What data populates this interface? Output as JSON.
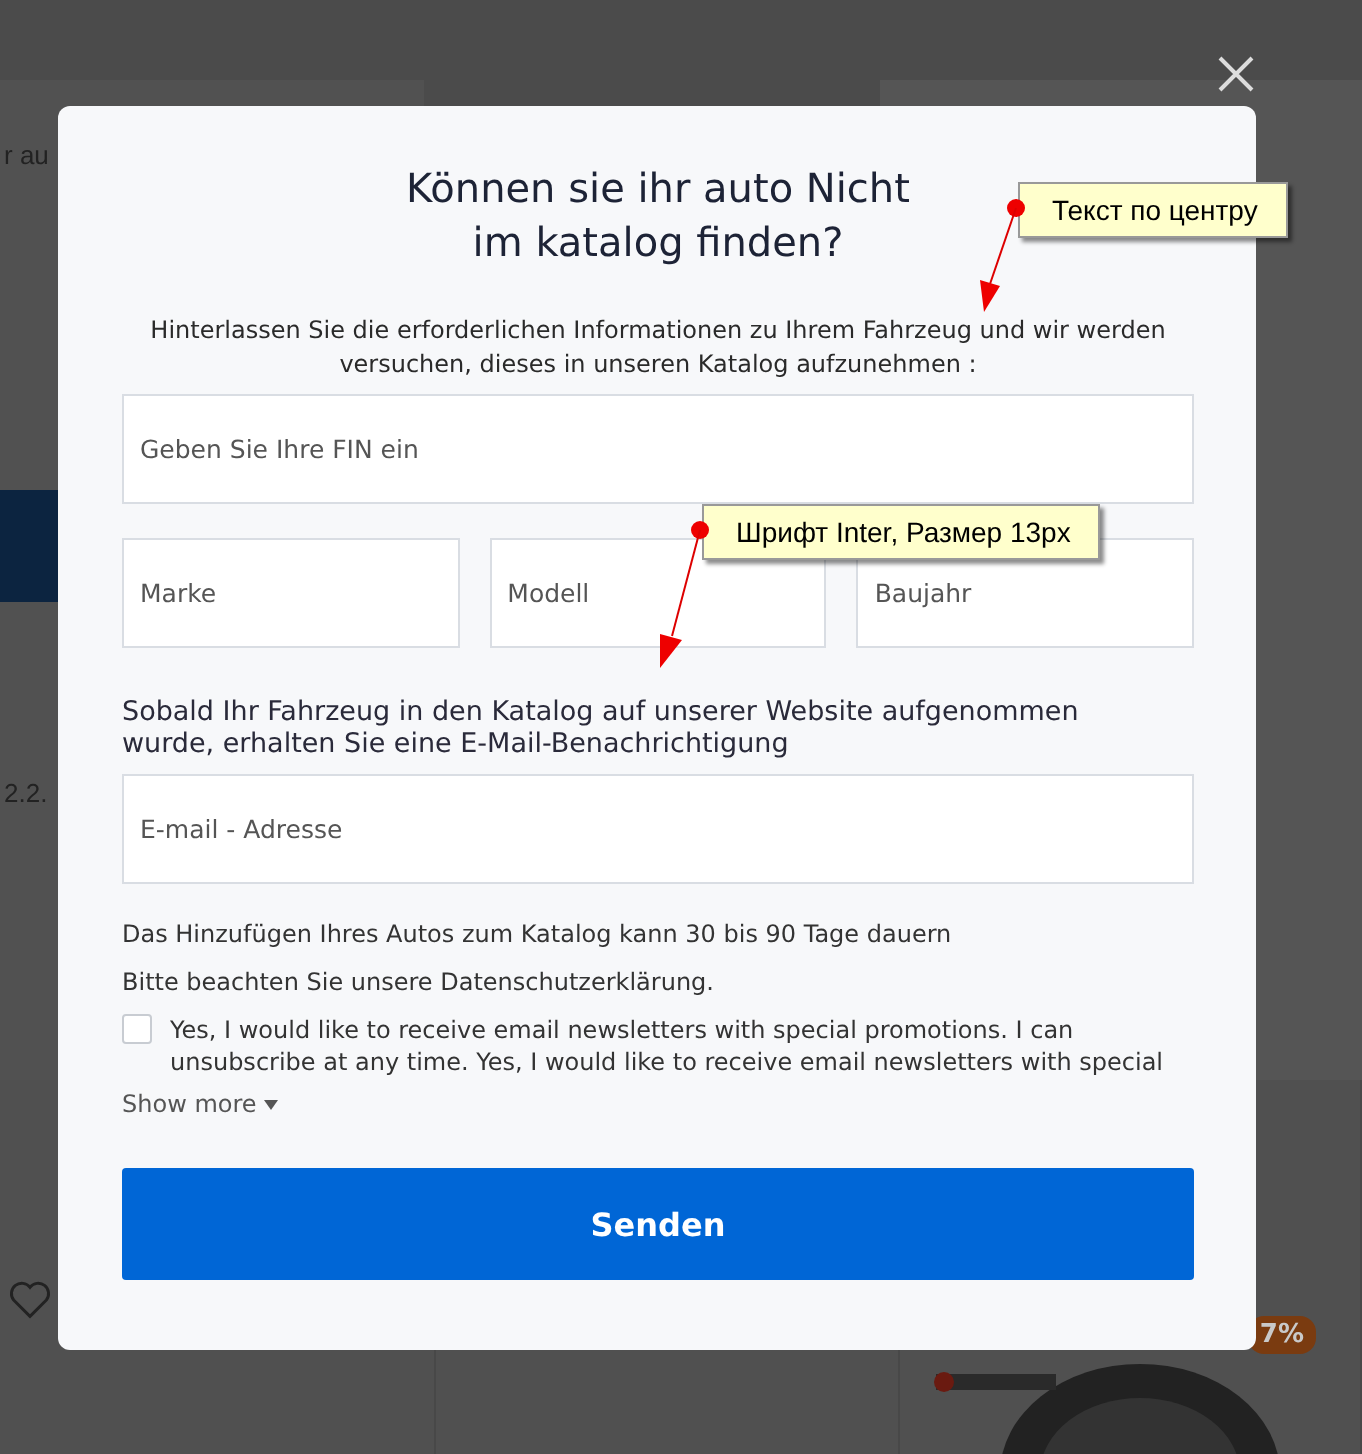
{
  "background": {
    "texts": [
      "r au",
      "2.2."
    ],
    "discount": "7%"
  },
  "modal": {
    "title_lines": [
      "Können sie ihr auto Nicht",
      "im katalog finden?"
    ],
    "intro": "Hinterlassen Sie die erforderlichen Informationen zu Ihrem Fahrzeug und wir werden versuchen, dieses in unseren Katalog aufzunehmen :",
    "vin_field": {
      "placeholder": "Geben Sie Ihre FIN ein"
    },
    "car_fields": [
      {
        "placeholder": "Marke"
      },
      {
        "placeholder": "Modell"
      },
      {
        "placeholder": "Baujahr"
      }
    ],
    "email_label": "Sobald Ihr Fahrzeug in den Katalog auf unserer Website aufgenommen wurde, erhalten Sie eine E-Mail-Benachrichtigung",
    "email_field": {
      "placeholder": "E-mail - Adresse"
    },
    "notes": [
      "Das Hinzufügen Ihres Autos zum Katalog kann 30 bis 90 Tage dauern",
      "Bitte beachten Sie unsere Datenschutzerklärung."
    ],
    "newsletter": {
      "checked": false,
      "text": "Yes, I would like to receive email newsletters with special promotions. I can unsubscribe at any time. Yes, I would like to receive email newsletters with special"
    },
    "show_more": "Show more",
    "submit": "Senden"
  },
  "annotations": [
    {
      "text": "Текст по центру"
    },
    {
      "text": "Шрифт Inter, Размер 13px"
    }
  ]
}
